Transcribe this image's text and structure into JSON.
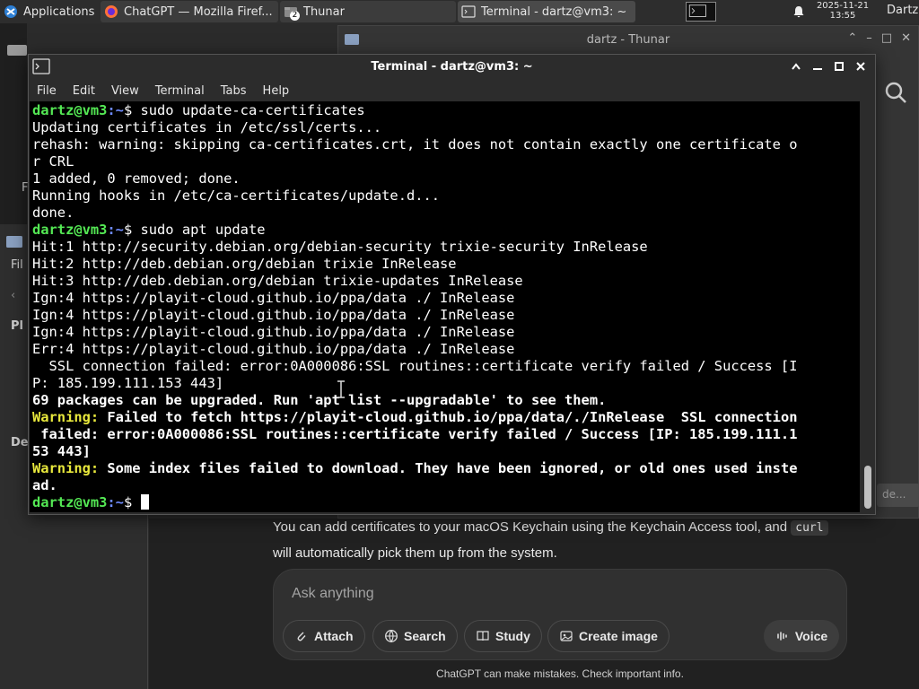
{
  "taskbar": {
    "applications_label": "Applications",
    "tasks": [
      {
        "label": "ChatGPT — Mozilla Firef..."
      },
      {
        "label": "Thunar",
        "badge": "2"
      },
      {
        "label": "Terminal - dartz@vm3: ~"
      }
    ],
    "clock_date": "2025-11-21",
    "clock_time": "13:55",
    "user": "Dartz"
  },
  "thunar": {
    "title": "dartz - Thunar",
    "hint": "de..."
  },
  "left_pane": {
    "labels": [
      "Fil",
      "Pl",
      "De",
      "F"
    ]
  },
  "terminal": {
    "title": "Terminal - dartz@vm3: ~",
    "menu": [
      "File",
      "Edit",
      "View",
      "Terminal",
      "Tabs",
      "Help"
    ],
    "prompt_user": "dartz@vm3",
    "prompt_path": ":~",
    "lines": [
      {
        "kind": "prompt",
        "cmd": "$ sudo update-ca-certificates"
      },
      {
        "kind": "out",
        "text": "Updating certificates in /etc/ssl/certs..."
      },
      {
        "kind": "out",
        "text": "rehash: warning: skipping ca-certificates.crt, it does not contain exactly one certificate o"
      },
      {
        "kind": "out",
        "text": "r CRL"
      },
      {
        "kind": "out",
        "text": "1 added, 0 removed; done."
      },
      {
        "kind": "out",
        "text": "Running hooks in /etc/ca-certificates/update.d..."
      },
      {
        "kind": "out",
        "text": "done."
      },
      {
        "kind": "prompt",
        "cmd": "$ sudo apt update"
      },
      {
        "kind": "out",
        "text": "Hit:1 http://security.debian.org/debian-security trixie-security InRelease"
      },
      {
        "kind": "out",
        "text": "Hit:2 http://deb.debian.org/debian trixie InRelease"
      },
      {
        "kind": "out",
        "text": "Hit:3 http://deb.debian.org/debian trixie-updates InRelease"
      },
      {
        "kind": "out",
        "text": "Ign:4 https://playit-cloud.github.io/ppa/data ./ InRelease"
      },
      {
        "kind": "out",
        "text": "Ign:4 https://playit-cloud.github.io/ppa/data ./ InRelease"
      },
      {
        "kind": "out",
        "text": "Ign:4 https://playit-cloud.github.io/ppa/data ./ InRelease"
      },
      {
        "kind": "out",
        "text": "Err:4 https://playit-cloud.github.io/ppa/data ./ InRelease"
      },
      {
        "kind": "out",
        "text": "  SSL connection failed: error:0A000086:SSL routines::certificate verify failed / Success [I"
      },
      {
        "kind": "out",
        "text": "P: 185.199.111.153 443]"
      },
      {
        "kind": "bold",
        "text": "69 packages can be upgraded. Run 'apt list --upgradable' to see them."
      },
      {
        "kind": "warn",
        "label": "Warning:",
        "text": " Failed to fetch https://playit-cloud.github.io/ppa/data/./InRelease  SSL connection"
      },
      {
        "kind": "bold",
        "text": " failed: error:0A000086:SSL routines::certificate verify failed / Success [IP: 185.199.111.1"
      },
      {
        "kind": "bold",
        "text": "53 443]"
      },
      {
        "kind": "warn",
        "label": "Warning:",
        "text": " Some index files failed to download. They have been ignored, or old ones used inste"
      },
      {
        "kind": "bold",
        "text": "ad."
      },
      {
        "kind": "prompt",
        "cmd": "$ ",
        "cursor": true
      }
    ]
  },
  "chat": {
    "answer_pre": "You can add certificates to your macOS Keychain using the Keychain Access tool, and ",
    "answer_code": "curl",
    "answer_post": " will automatically pick them up from the system.",
    "composer_placeholder": "Ask anything",
    "chips": [
      "Attach",
      "Search",
      "Study",
      "Create image"
    ],
    "voice_label": "Voice",
    "disclaimer": "ChatGPT can make mistakes. Check important info."
  },
  "colors": {
    "prompt_user": "#54e854",
    "prompt_path": "#6f8cff",
    "warning": "#e8e83c",
    "terminal_bg": "#000000"
  }
}
